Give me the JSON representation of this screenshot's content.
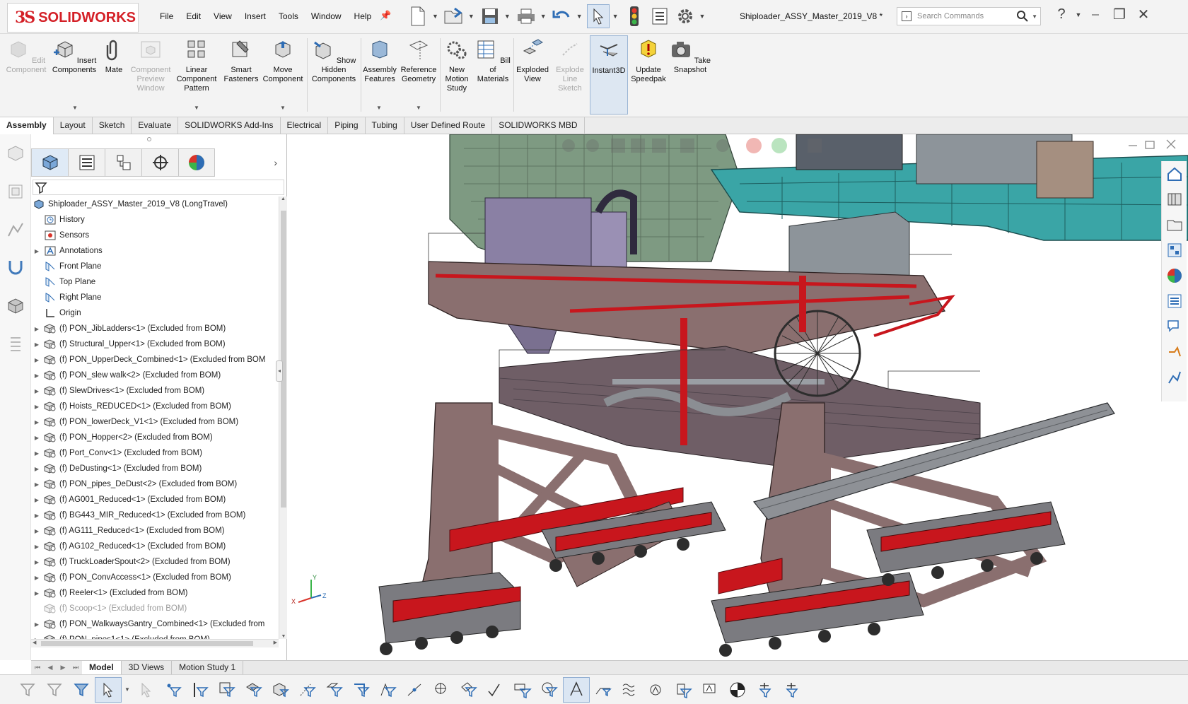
{
  "app": {
    "brand_mark": "3S",
    "brand_name": "SOLIDWORKS",
    "document_title": "Shiploader_ASSY_Master_2019_V8 *"
  },
  "menu": [
    "File",
    "Edit",
    "View",
    "Insert",
    "Tools",
    "Window",
    "Help"
  ],
  "search": {
    "placeholder": "Search Commands"
  },
  "ribbon": [
    {
      "label": "Edit Component",
      "icon": "edit-component-icon",
      "disabled": true
    },
    {
      "label": "Insert Components",
      "icon": "insert-components-icon",
      "disabled": false
    },
    {
      "label": "Mate",
      "icon": "mate-icon",
      "disabled": false
    },
    {
      "label": "Component Preview Window",
      "icon": "preview-window-icon",
      "disabled": true
    },
    {
      "label": "Linear Component Pattern",
      "icon": "linear-pattern-icon",
      "disabled": false
    },
    {
      "label": "Smart Fasteners",
      "icon": "smart-fasteners-icon",
      "disabled": false
    },
    {
      "label": "Move Component",
      "icon": "move-component-icon",
      "disabled": false
    },
    {
      "label": "Show Hidden Components",
      "icon": "show-hidden-icon",
      "disabled": false
    },
    {
      "label": "Assembly Features",
      "icon": "assembly-features-icon",
      "disabled": false
    },
    {
      "label": "Reference Geometry",
      "icon": "reference-geometry-icon",
      "disabled": false
    },
    {
      "label": "New Motion Study",
      "icon": "motion-study-icon",
      "disabled": false
    },
    {
      "label": "Bill of Materials",
      "icon": "bom-icon",
      "disabled": false
    },
    {
      "label": "Exploded View",
      "icon": "exploded-view-icon",
      "disabled": false
    },
    {
      "label": "Explode Line Sketch",
      "icon": "explode-line-icon",
      "disabled": true
    },
    {
      "label": "Instant3D",
      "icon": "instant3d-icon",
      "disabled": false,
      "active": true
    },
    {
      "label": "Update Speedpak",
      "icon": "speedpak-icon",
      "disabled": false
    },
    {
      "label": "Take Snapshot",
      "icon": "snapshot-icon",
      "disabled": false
    }
  ],
  "tabs": [
    {
      "label": "Assembly",
      "active": true
    },
    {
      "label": "Layout"
    },
    {
      "label": "Sketch"
    },
    {
      "label": "Evaluate"
    },
    {
      "label": "SOLIDWORKS Add-Ins"
    },
    {
      "label": "Electrical"
    },
    {
      "label": "Piping"
    },
    {
      "label": "Tubing"
    },
    {
      "label": "User Defined Route"
    },
    {
      "label": "SOLIDWORKS MBD"
    }
  ],
  "tree": {
    "root": "Shiploader_ASSY_Master_2019_V8  (LongTravel)",
    "items": [
      {
        "label": "History",
        "icon": "history-icon",
        "expandable": false
      },
      {
        "label": "Sensors",
        "icon": "sensors-icon",
        "expandable": false
      },
      {
        "label": "Annotations",
        "icon": "annotations-icon",
        "expandable": true
      },
      {
        "label": "Front Plane",
        "icon": "plane-icon",
        "expandable": false
      },
      {
        "label": "Top Plane",
        "icon": "plane-icon",
        "expandable": false
      },
      {
        "label": "Right Plane",
        "icon": "plane-icon",
        "expandable": false
      },
      {
        "label": "Origin",
        "icon": "origin-icon",
        "expandable": false
      },
      {
        "label": "(f) PON_JibLadders<1> (Excluded from BOM)",
        "icon": "subassembly-icon",
        "expandable": true
      },
      {
        "label": "(f) Structural_Upper<1> (Excluded from BOM)",
        "icon": "subassembly-icon",
        "expandable": true
      },
      {
        "label": "(f) PON_UpperDeck_Combined<1> (Excluded from BOM",
        "icon": "subassembly-icon",
        "expandable": true
      },
      {
        "label": "(f) PON_slew walk<2> (Excluded from BOM)",
        "icon": "subassembly-icon",
        "expandable": true
      },
      {
        "label": "(f) SlewDrives<1> (Excluded from BOM)",
        "icon": "subassembly-icon",
        "expandable": true
      },
      {
        "label": "(f) Hoists_REDUCED<1> (Excluded from BOM)",
        "icon": "subassembly-icon",
        "expandable": true
      },
      {
        "label": "(f) PON_lowerDeck_V1<1> (Excluded from BOM)",
        "icon": "subassembly-icon",
        "expandable": true
      },
      {
        "label": "(f) PON_Hopper<2> (Excluded from BOM)",
        "icon": "subassembly-icon",
        "expandable": true
      },
      {
        "label": "(f) Port_Conv<1> (Excluded from BOM)",
        "icon": "subassembly-icon",
        "expandable": true
      },
      {
        "label": "(f) DeDusting<1> (Excluded from BOM)",
        "icon": "subassembly-icon",
        "expandable": true
      },
      {
        "label": "(f) PON_pipes_DeDust<2> (Excluded from BOM)",
        "icon": "subassembly-icon",
        "expandable": true
      },
      {
        "label": "(f) AG001_Reduced<1> (Excluded from BOM)",
        "icon": "subassembly-icon",
        "expandable": true
      },
      {
        "label": "(f) BG443_MIR_Reduced<1> (Excluded from BOM)",
        "icon": "subassembly-icon",
        "expandable": true
      },
      {
        "label": "(f) AG111_Reduced<1> (Excluded from BOM)",
        "icon": "subassembly-icon",
        "expandable": true
      },
      {
        "label": "(f) AG102_Reduced<1> (Excluded from BOM)",
        "icon": "subassembly-icon",
        "expandable": true
      },
      {
        "label": "(f) TruckLoaderSpout<2> (Excluded from BOM)",
        "icon": "subassembly-icon",
        "expandable": true
      },
      {
        "label": "(f) PON_ConvAccess<1> (Excluded from BOM)",
        "icon": "subassembly-icon",
        "expandable": true
      },
      {
        "label": "(f) Reeler<1> (Excluded from BOM)",
        "icon": "subassembly-icon",
        "expandable": true
      },
      {
        "label": "(f) Scoop<1> (Excluded from BOM)",
        "icon": "subassembly-icon",
        "expandable": false,
        "dim": true
      },
      {
        "label": "(f) PON_WalkwaysGantry_Combined<1> (Excluded from",
        "icon": "subassembly-icon",
        "expandable": true
      },
      {
        "label": "(f) PON_pipes1<1> (Excluded from BOM)",
        "icon": "subassembly-icon",
        "expandable": true
      }
    ]
  },
  "bottom_tabs": [
    {
      "label": "Model",
      "active": true
    },
    {
      "label": "3D Views"
    },
    {
      "label": "Motion Study 1"
    }
  ],
  "triad": {
    "x": "X",
    "y": "Y",
    "z": "Z"
  },
  "colors": {
    "brand": "#d42027",
    "accent": "#2e6db5",
    "frame": "#8a6f6f",
    "deck": "#3aa5a6",
    "house": "#7e9a82",
    "rail": "#c8161d"
  }
}
